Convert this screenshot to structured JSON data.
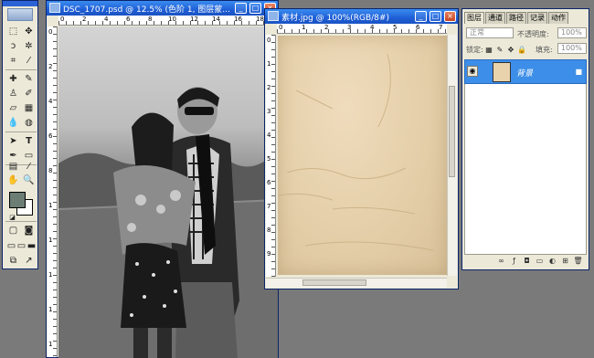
{
  "tools_palette": {
    "tools": [
      "marquee",
      "move",
      "lasso",
      "magic-wand",
      "crop",
      "slice",
      "healing-brush",
      "brush",
      "clone-stamp",
      "history-brush",
      "eraser",
      "gradient",
      "blur",
      "dodge",
      "path-select",
      "type",
      "pen",
      "shape",
      "notes",
      "eyedropper",
      "hand",
      "zoom"
    ],
    "foreground_color": "#6c7d74",
    "background_color": "#ffffff"
  },
  "document_photo": {
    "title": "DSC_1707.psd @ 12.5% (色阶 1, 图层蒙...",
    "ruler_h": [
      "0",
      "2",
      "4",
      "6",
      "8",
      "10",
      "12",
      "14",
      "16",
      "18"
    ],
    "ruler_v": [
      "0",
      "2",
      "4",
      "6",
      "8",
      "1",
      "1",
      "1",
      "1",
      "1"
    ]
  },
  "document_paper": {
    "title": "素材.jpg @ 100%(RGB/8#)",
    "ruler_h": [
      "0",
      "1",
      "2",
      "3",
      "4",
      "5",
      "6",
      "7"
    ],
    "ruler_v": [
      "0",
      "1",
      "2",
      "3",
      "4",
      "5",
      "6",
      "7",
      "8",
      "9"
    ]
  },
  "layers_panel": {
    "tabs": [
      "图层",
      "通道",
      "路径",
      "记录",
      "动作"
    ],
    "blend_mode": "正常",
    "opacity_label": "不透明度:",
    "opacity_value": "100%",
    "lock_label": "锁定:",
    "fill_label": "填充:",
    "fill_value": "100%",
    "layer_name": "背景"
  },
  "window_buttons": {
    "minimize": "_",
    "maximize": "□",
    "close": "×"
  },
  "colors": {
    "titlebar": "#1f5fd6",
    "selection": "#3d8ee8",
    "workspace": "#7a7a7a",
    "paper": "#e3cda7"
  }
}
